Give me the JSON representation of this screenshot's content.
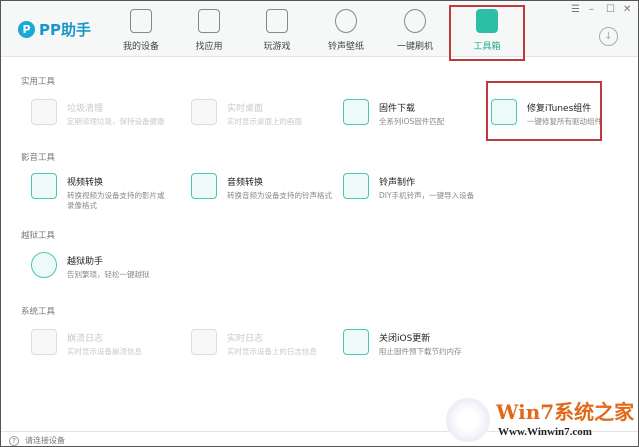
{
  "app": {
    "logo_mark": "P",
    "title": "PP助手"
  },
  "nav": [
    {
      "label": "我的设备"
    },
    {
      "label": "找应用"
    },
    {
      "label": "玩游戏"
    },
    {
      "label": "铃声壁纸"
    },
    {
      "label": "一键刷机"
    },
    {
      "label": "工具箱"
    }
  ],
  "window_controls": {
    "menu": "☰",
    "minimize": "–",
    "maximize": "☐",
    "close": "✕",
    "download": "↓"
  },
  "sections": [
    {
      "title": "实用工具",
      "items": [
        {
          "title": "垃圾清理",
          "desc": "定期清理垃圾，保持设备健康"
        },
        {
          "title": "实时桌面",
          "desc": "实时显示桌面上的画面"
        },
        {
          "title": "固件下载",
          "desc": "全系列iOS固件匹配"
        },
        {
          "title": "修复iTunes组件",
          "desc": "一键修复所有驱动组件"
        }
      ]
    },
    {
      "title": "影音工具",
      "items": [
        {
          "title": "视频转换",
          "desc": "转换视频为设备支持的影片或录像格式"
        },
        {
          "title": "音频转换",
          "desc": "转换音频为设备支持的铃声格式"
        },
        {
          "title": "铃声制作",
          "desc": "DIY手机铃声，一键导入设备"
        }
      ]
    },
    {
      "title": "越狱工具",
      "items": [
        {
          "title": "越狱助手",
          "desc": "告别繁琐，轻松一键越狱"
        }
      ]
    },
    {
      "title": "系统工具",
      "items": [
        {
          "title": "崩溃日志",
          "desc": "实时显示设备崩溃信息"
        },
        {
          "title": "实时日志",
          "desc": "实时显示设备上的日志信息"
        },
        {
          "title": "关闭iOS更新",
          "desc": "阻止固件预下载节约内存"
        }
      ]
    }
  ],
  "status": {
    "icon": "?",
    "text": "请连接设备"
  },
  "watermark": {
    "title": "Win7系统之家",
    "url": "Www.Winwin7.com"
  },
  "colors": {
    "accent": "#2bbfa7",
    "highlight": "#c0393b"
  }
}
